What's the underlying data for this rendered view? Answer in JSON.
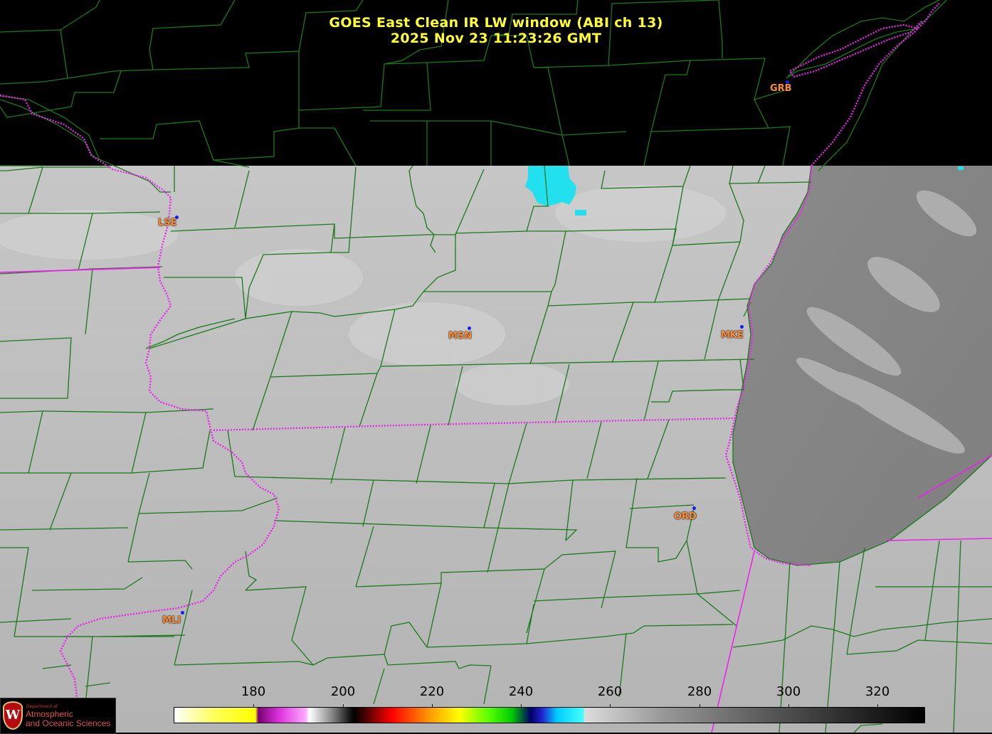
{
  "title": {
    "line1": "GOES East Clean IR LW window (ABI ch 13)",
    "line2": "2025 Nov 23  11:23:26 GMT"
  },
  "stations": [
    {
      "code": "GRB"
    },
    {
      "code": "LSE"
    },
    {
      "code": "MSN"
    },
    {
      "code": "MKE"
    },
    {
      "code": "ORD"
    },
    {
      "code": "MLI"
    }
  ],
  "colorbar": {
    "ticks": [
      "180",
      "200",
      "220",
      "240",
      "260",
      "280",
      "300",
      "320"
    ]
  },
  "logo": {
    "small": "Department of",
    "line1": "Atmospheric",
    "line2": "and Oceanic Sciences",
    "badge": "W"
  },
  "colors": {
    "title": "#ffff33",
    "station_label": "#ff8c33",
    "station_dot": "#1020ff",
    "county_lines": "#1a7a1a",
    "state_lines": "#ee22ee",
    "cold_cloud": "#22e0ee"
  }
}
